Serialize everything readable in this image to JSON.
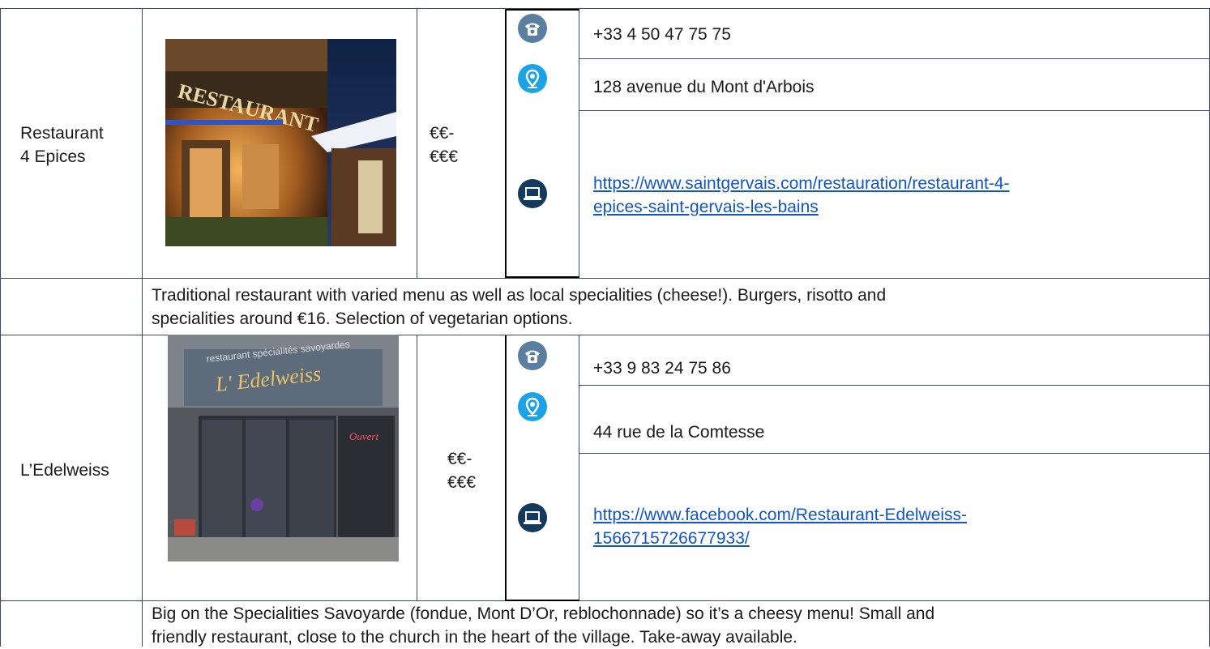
{
  "restaurants": [
    {
      "name_line1": "Restaurant",
      "name_line2": "4 Epices",
      "price_line1": "€€-",
      "price_line2": "€€€",
      "phone": "+33 4 50 47 75 75",
      "address": "128 avenue du Mont d'Arbois",
      "url_line1": "https://www.saintgervais.com/restauration/restaurant-4-",
      "url_line2": "epices-saint-gervais-les-bains",
      "description_line1": "Traditional restaurant with varied menu as well as local specialities (cheese!). Burgers, risotto and",
      "description_line2": "specialities around €16. Selection of vegetarian options."
    },
    {
      "name": "L’Edelweiss",
      "sign_text": "L' Edelweiss",
      "sign_subtext": "restaurant spécialités savoyardes",
      "door_sign": "Ouvert",
      "price_line1": "€€-",
      "price_line2": "€€€",
      "phone": "+33 9 83 24 75 86",
      "address": "44 rue de la Comtesse",
      "url_line1": "https://www.facebook.com/Restaurant-Edelweiss-",
      "url_line2": "1566715726677933/",
      "description_line1": "Big on the Specialities Savoyarde (fondue, Mont D’Or, reblochonnade) so it’s a cheesy menu! Small and",
      "description_line2": "friendly restaurant, close to the church in the heart of the village. Take-away available."
    }
  ],
  "icons": {
    "phone": "phone-icon",
    "location": "location-pin-icon",
    "web": "laptop-icon"
  },
  "colors": {
    "phone_icon": "#5a7fa0",
    "location_icon": "#1aa3e8",
    "web_icon": "#123a5e",
    "link": "#1155cc"
  }
}
